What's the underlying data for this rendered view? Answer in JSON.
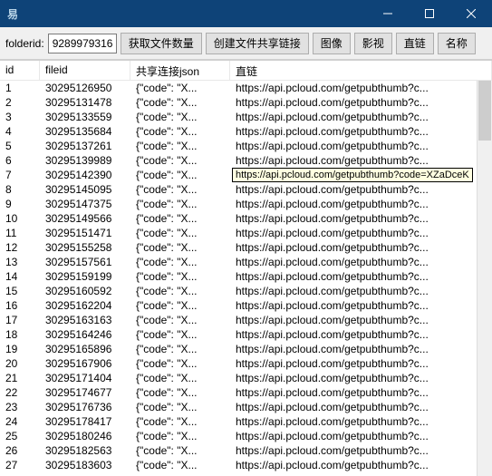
{
  "window": {
    "title": "易"
  },
  "toolbar": {
    "folderid_label": "folderid:",
    "folderid_value": "9289979316",
    "btn_getcount": "获取文件数量",
    "btn_createlink": "创建文件共享链接",
    "btn_image": "图像",
    "btn_video": "影视",
    "btn_direct": "直链",
    "btn_name": "名称"
  },
  "columns": {
    "c0": "id",
    "c1": "fileid",
    "c2": "共享连接json",
    "c3": "直链"
  },
  "tooltip": "https://api.pcloud.com/getpubthumb?code=XZaDceK",
  "rows": [
    {
      "id": "1",
      "fileid": "30295126950",
      "json": "{\"code\": \"X...",
      "url": "https://api.pcloud.com/getpubthumb?c..."
    },
    {
      "id": "2",
      "fileid": "30295131478",
      "json": "{\"code\": \"X...",
      "url": "https://api.pcloud.com/getpubthumb?c..."
    },
    {
      "id": "3",
      "fileid": "30295133559",
      "json": "{\"code\": \"X...",
      "url": "https://api.pcloud.com/getpubthumb?c..."
    },
    {
      "id": "4",
      "fileid": "30295135684",
      "json": "{\"code\": \"X...",
      "url": "https://api.pcloud.com/getpubthumb?c..."
    },
    {
      "id": "5",
      "fileid": "30295137261",
      "json": "{\"code\": \"X...",
      "url": "https://api.pcloud.com/getpubthumb?c..."
    },
    {
      "id": "6",
      "fileid": "30295139989",
      "json": "{\"code\": \"X...",
      "url": "https://api.pcloud.com/getpubthumb?c..."
    },
    {
      "id": "7",
      "fileid": "30295142390",
      "json": "{\"code\": \"X...",
      "url": "https://api.pcloud.com/getpubthumb?c..."
    },
    {
      "id": "8",
      "fileid": "30295145095",
      "json": "{\"code\": \"X...",
      "url": "https://api.pcloud.com/getpubthumb?c..."
    },
    {
      "id": "9",
      "fileid": "30295147375",
      "json": "{\"code\": \"X...",
      "url": "https://api.pcloud.com/getpubthumb?c..."
    },
    {
      "id": "10",
      "fileid": "30295149566",
      "json": "{\"code\": \"X...",
      "url": "https://api.pcloud.com/getpubthumb?c..."
    },
    {
      "id": "11",
      "fileid": "30295151471",
      "json": "{\"code\": \"X...",
      "url": "https://api.pcloud.com/getpubthumb?c..."
    },
    {
      "id": "12",
      "fileid": "30295155258",
      "json": "{\"code\": \"X...",
      "url": "https://api.pcloud.com/getpubthumb?c..."
    },
    {
      "id": "13",
      "fileid": "30295157561",
      "json": "{\"code\": \"X...",
      "url": "https://api.pcloud.com/getpubthumb?c..."
    },
    {
      "id": "14",
      "fileid": "30295159199",
      "json": "{\"code\": \"X...",
      "url": "https://api.pcloud.com/getpubthumb?c..."
    },
    {
      "id": "15",
      "fileid": "30295160592",
      "json": "{\"code\": \"X...",
      "url": "https://api.pcloud.com/getpubthumb?c..."
    },
    {
      "id": "16",
      "fileid": "30295162204",
      "json": "{\"code\": \"X...",
      "url": "https://api.pcloud.com/getpubthumb?c..."
    },
    {
      "id": "17",
      "fileid": "30295163163",
      "json": "{\"code\": \"X...",
      "url": "https://api.pcloud.com/getpubthumb?c..."
    },
    {
      "id": "18",
      "fileid": "30295164246",
      "json": "{\"code\": \"X...",
      "url": "https://api.pcloud.com/getpubthumb?c..."
    },
    {
      "id": "19",
      "fileid": "30295165896",
      "json": "{\"code\": \"X...",
      "url": "https://api.pcloud.com/getpubthumb?c..."
    },
    {
      "id": "20",
      "fileid": "30295167906",
      "json": "{\"code\": \"X...",
      "url": "https://api.pcloud.com/getpubthumb?c..."
    },
    {
      "id": "21",
      "fileid": "30295171404",
      "json": "{\"code\": \"X...",
      "url": "https://api.pcloud.com/getpubthumb?c..."
    },
    {
      "id": "22",
      "fileid": "30295174677",
      "json": "{\"code\": \"X...",
      "url": "https://api.pcloud.com/getpubthumb?c..."
    },
    {
      "id": "23",
      "fileid": "30295176736",
      "json": "{\"code\": \"X...",
      "url": "https://api.pcloud.com/getpubthumb?c..."
    },
    {
      "id": "24",
      "fileid": "30295178417",
      "json": "{\"code\": \"X...",
      "url": "https://api.pcloud.com/getpubthumb?c..."
    },
    {
      "id": "25",
      "fileid": "30295180246",
      "json": "{\"code\": \"X...",
      "url": "https://api.pcloud.com/getpubthumb?c..."
    },
    {
      "id": "26",
      "fileid": "30295182563",
      "json": "{\"code\": \"X...",
      "url": "https://api.pcloud.com/getpubthumb?c..."
    },
    {
      "id": "27",
      "fileid": "30295183603",
      "json": "{\"code\": \"X...",
      "url": "https://api.pcloud.com/getpubthumb?c..."
    }
  ]
}
